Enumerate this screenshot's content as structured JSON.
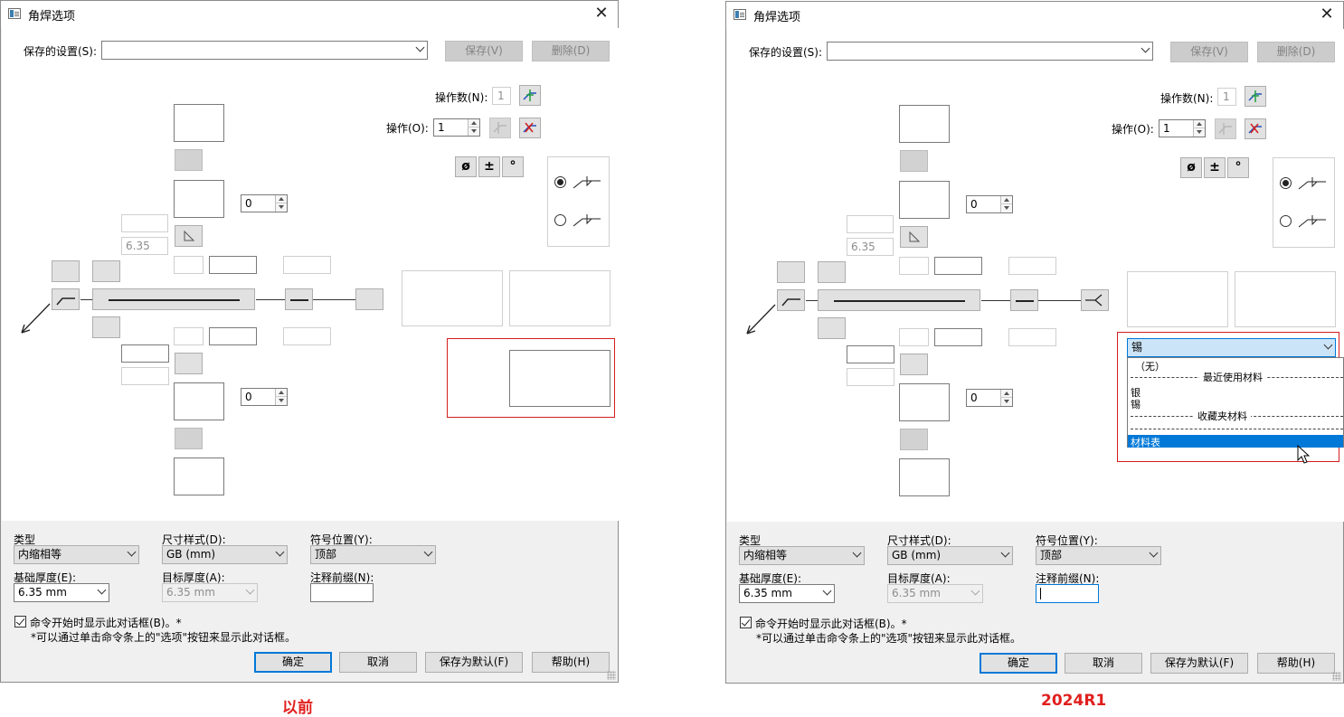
{
  "dialog": {
    "title": "角焊选项",
    "close_glyph": "✕",
    "saved_settings_label": "保存的设置(S):",
    "save_btn": "保存(V)",
    "delete_btn": "删除(D)",
    "op_count_label": "操作数(N):",
    "op_count_value": "1",
    "op_label": "操作(O):",
    "op_value": "1",
    "spin_top_value": "0",
    "spin_bottom_value": "0",
    "thickness_placeholder": "6.35",
    "sym_diameter": "ø",
    "sym_plusminus": "±",
    "sym_degree": "°",
    "type_label": "类型",
    "type_value": "内缩相等",
    "dim_style_label": "尺寸样式(D):",
    "dim_style_value": "GB (mm)",
    "symbol_pos_label": "符号位置(Y):",
    "symbol_pos_value": "顶部",
    "base_thickness_label": "基础厚度(E):",
    "base_thickness_value": "6.35 mm",
    "target_thickness_label": "目标厚度(A):",
    "target_thickness_value": "6.35 mm",
    "note_prefix_label": "注释前缀(N):",
    "show_dialog_label": "命令开始时显示此对话框(B)。*",
    "note_text": "*可以通过单击命令条上的\"选项\"按钮来显示此对话框。",
    "ok_btn": "确定",
    "cancel_btn": "取消",
    "save_default_btn": "保存为默认(F)",
    "help_btn": "帮助(H)"
  },
  "captions": {
    "before": "以前",
    "after": "2024R1"
  },
  "material_dropdown": {
    "selected": "锡",
    "items": [
      {
        "text": "（无）"
      },
      {
        "separator": "最近使用材料"
      },
      {
        "text": "银"
      },
      {
        "text": "锡"
      },
      {
        "separator": "收藏夹材料"
      },
      {
        "separator": ""
      },
      {
        "text": "材料表",
        "highlighted": true
      }
    ]
  },
  "colors": {
    "accent": "#0078d7",
    "highlight_red": "#d21e1e",
    "caption_red": "#e0201e"
  }
}
